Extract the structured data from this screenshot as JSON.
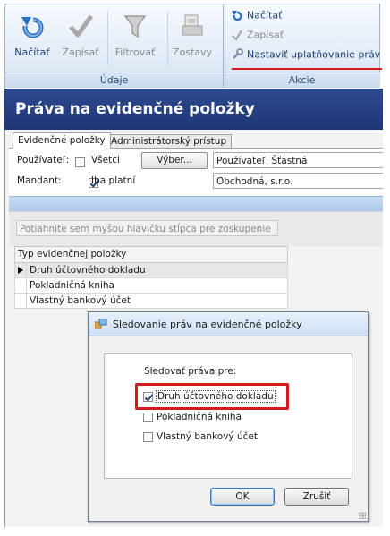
{
  "ribbon": {
    "buttons": {
      "nacitat": "Načítať",
      "zapisat": "Zapísať",
      "filtrovat": "Filtrovať",
      "zostavy": "Zostavy"
    },
    "groups": {
      "udaje": "Údaje",
      "akcie": "Akcie"
    },
    "actions": {
      "nacitat": "Načítať",
      "zapisat": "Zapísať",
      "nastavit": "Nastaviť uplatňovanie práv"
    }
  },
  "window": {
    "title": "Práva na evidenčné položky",
    "tabs": [
      "Evidenčné položky",
      "Administrátorský prístup"
    ],
    "form": {
      "user_label": "Používateľ:",
      "all_label": "Všetci",
      "all_checked": false,
      "select_button": "Výber...",
      "user_value": "Používateľ: Šťastná",
      "mandant_label": "Mandant:",
      "only_valid_label": "Iba platní",
      "only_valid_checked": true,
      "mandant_value": "Obchodná, s.r.o."
    },
    "group_hint": "Potiahnite sem myšou hlavičku stĺpca pre zoskupenie",
    "grid": {
      "column": "Typ evidenčnej položky",
      "rows": [
        "Druh účtovného dokladu",
        "Pokladničná kniha",
        "Vlastný bankový účet"
      ]
    }
  },
  "dialog": {
    "title": "Sledovanie práv na evidenčné položky",
    "prompt": "Sledovať práva pre:",
    "options": [
      {
        "label": "Druh účtovného dokladu",
        "checked": true
      },
      {
        "label": "Pokladničná kniha",
        "checked": false
      },
      {
        "label": "Vlastný bankový účet",
        "checked": false
      }
    ],
    "ok": "OK",
    "cancel": "Zrušiť"
  },
  "colors": {
    "title_bar": "#1f3676",
    "highlight_red": "#d31b1b",
    "ribbon_blue": "#dbe6f4"
  }
}
